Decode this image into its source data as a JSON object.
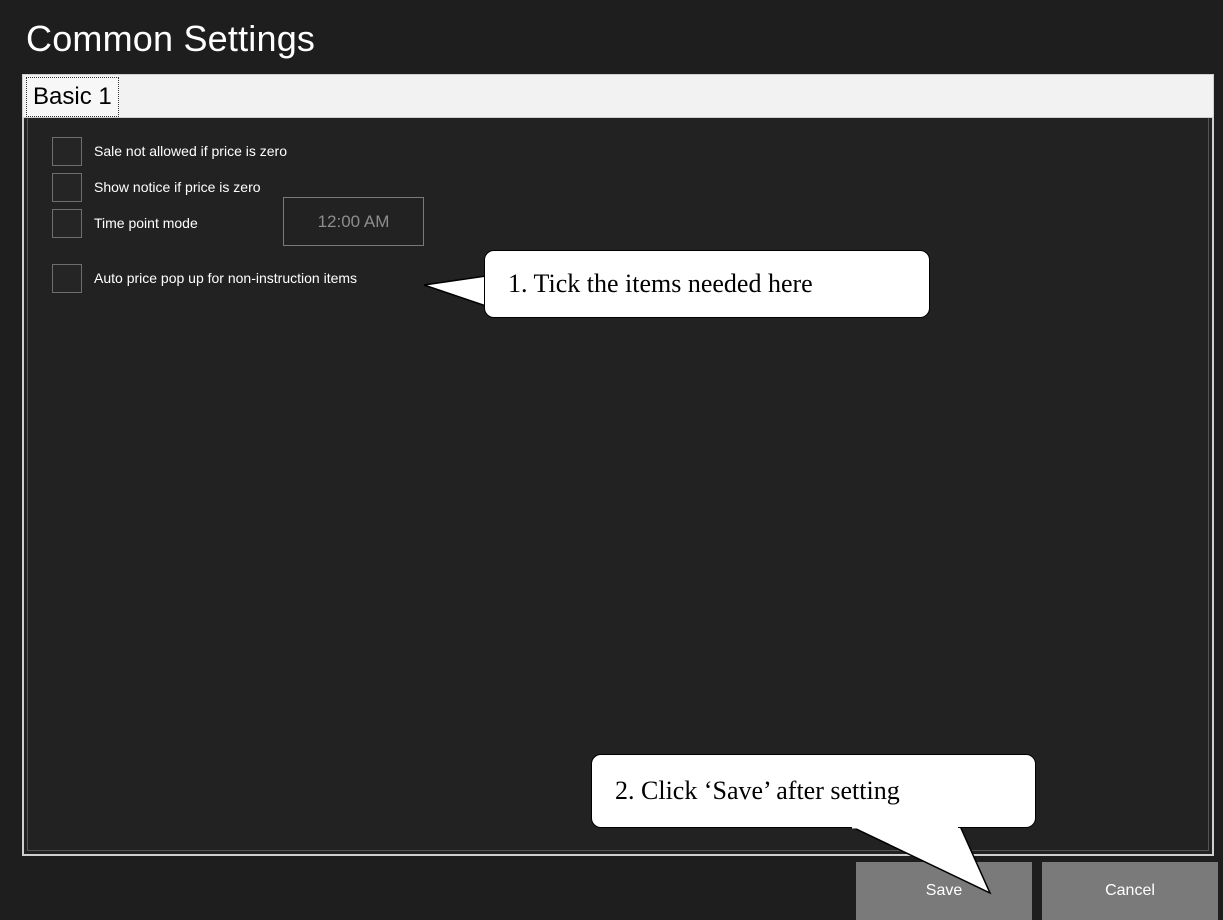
{
  "window": {
    "title": "Common Settings"
  },
  "tabs": [
    {
      "label": "Basic 1",
      "active": true
    }
  ],
  "settings": [
    {
      "label": "Sale not allowed if price is zero",
      "checked": false
    },
    {
      "label": "Show notice if price is zero",
      "checked": false
    },
    {
      "label": "Time point mode",
      "checked": false
    },
    {
      "label": "Auto price pop up for non-instruction items",
      "checked": false
    }
  ],
  "time_point": {
    "value": "12:00 AM"
  },
  "buttons": {
    "save": "Save",
    "cancel": "Cancel"
  },
  "annotations": {
    "callout1": "1. Tick the items needed here",
    "callout2": "2. Click ‘Save’ after setting"
  },
  "colors": {
    "background": "#1e1e1e",
    "panel": "#222222",
    "button": "#7a7a7a",
    "tabstrip": "#f2f2f2",
    "callout": "#ffffff"
  }
}
